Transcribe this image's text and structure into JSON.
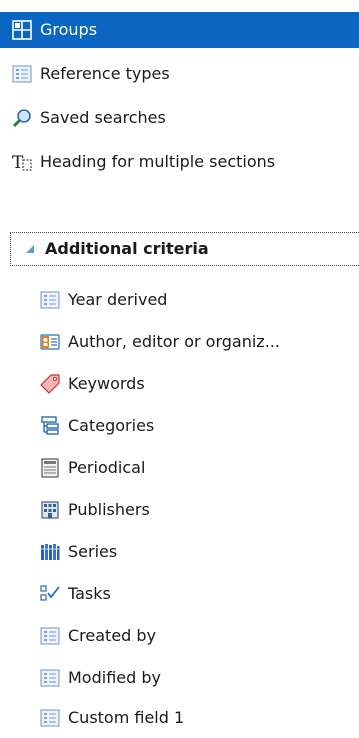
{
  "top_items": [
    {
      "label": "Groups",
      "icon": "groups-icon"
    },
    {
      "label": "Reference types",
      "icon": "field-list-icon"
    },
    {
      "label": "Saved searches",
      "icon": "saved-search-icon"
    },
    {
      "label": "Heading for multiple sections",
      "icon": "heading-icon"
    }
  ],
  "group": {
    "label": "Additional criteria",
    "items": [
      {
        "label": "Year derived",
        "icon": "field-list-icon"
      },
      {
        "label": "Author, editor or organiz...",
        "icon": "person-card-icon"
      },
      {
        "label": "Keywords",
        "icon": "tag-icon"
      },
      {
        "label": "Categories",
        "icon": "category-tree-icon"
      },
      {
        "label": "Periodical",
        "icon": "periodical-icon"
      },
      {
        "label": "Publishers",
        "icon": "publisher-building-icon"
      },
      {
        "label": "Series",
        "icon": "series-books-icon"
      },
      {
        "label": "Tasks",
        "icon": "tasks-checklist-icon"
      },
      {
        "label": "Created by",
        "icon": "field-list-icon"
      },
      {
        "label": "Modified by",
        "icon": "field-list-icon"
      },
      {
        "label": "Custom field 1",
        "icon": "field-list-icon"
      }
    ]
  },
  "colors": {
    "selection": "#0a66c2",
    "icon_blue": "#2b6cb0"
  }
}
